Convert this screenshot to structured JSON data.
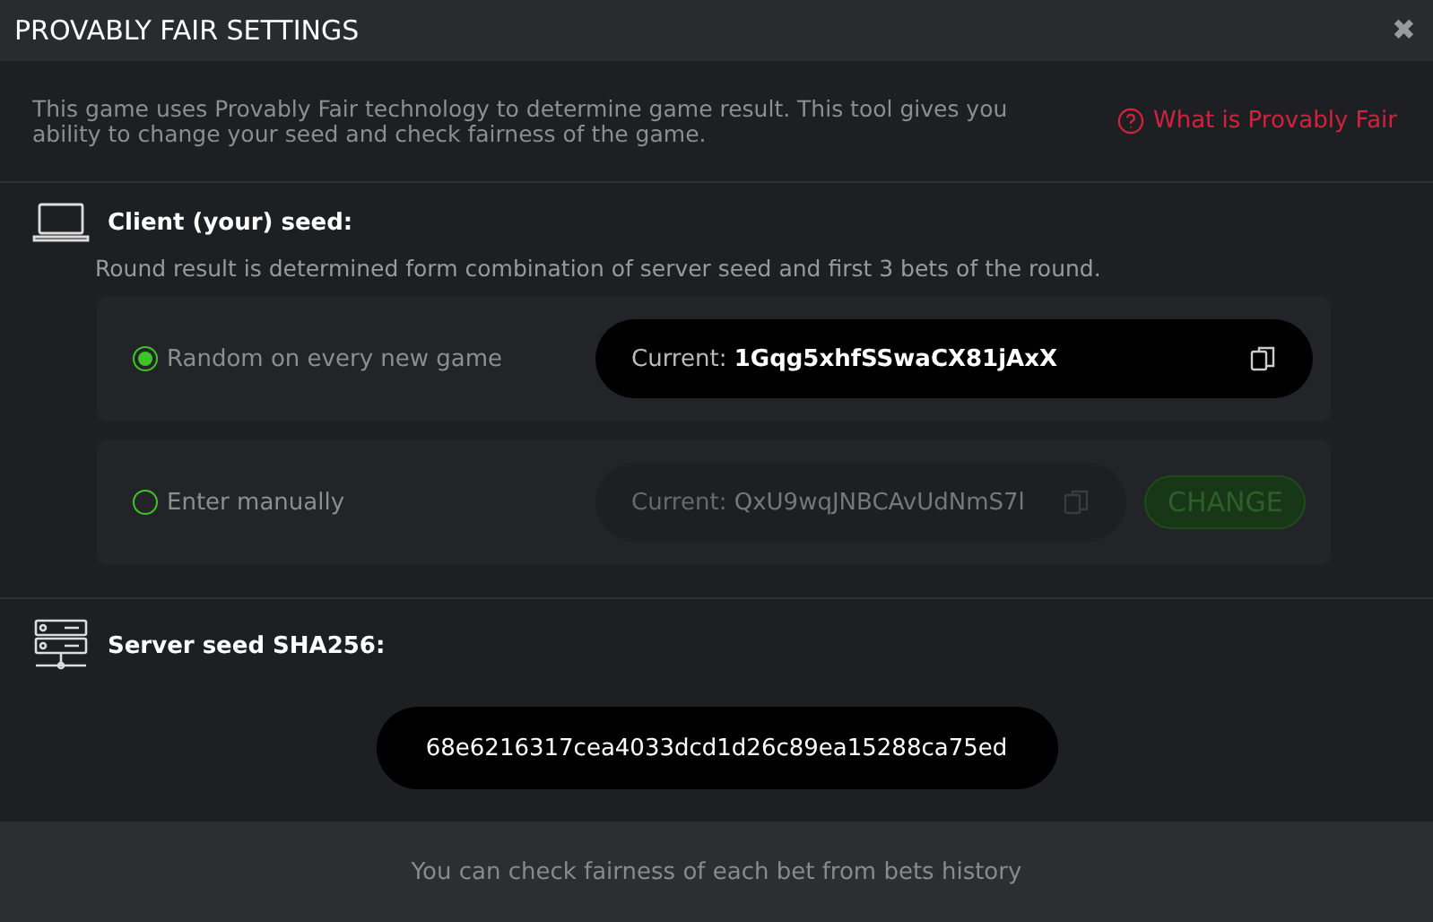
{
  "window": {
    "title": "PROVABLY FAIR SETTINGS",
    "close": "✖"
  },
  "intro": {
    "text": "This game uses Provably Fair technology to determine game result. This tool gives you ability to change your seed and check fairness of the game.",
    "link": "What is Provably Fair"
  },
  "client_seed": {
    "title": "Client (your) seed:",
    "description": "Round result is determined form combination of server seed and first 3 bets of the round.",
    "options": [
      {
        "label": "Random on every new game",
        "selected": true,
        "disabled": false,
        "current_label": "Current:",
        "value": "1Gqg5xhfSSwaCX81jAxX"
      },
      {
        "label": "Enter manually",
        "selected": false,
        "disabled": true,
        "current_label": "Current:",
        "value": "QxU9wqJNBCAvUdNmS7l",
        "button": "CHANGE"
      }
    ]
  },
  "server_seed": {
    "title": "Server seed SHA256:",
    "value": "68e6216317cea4033dcd1d26c89ea15288ca75ed"
  },
  "footer": "You can check fairness of each bet from bets history"
}
